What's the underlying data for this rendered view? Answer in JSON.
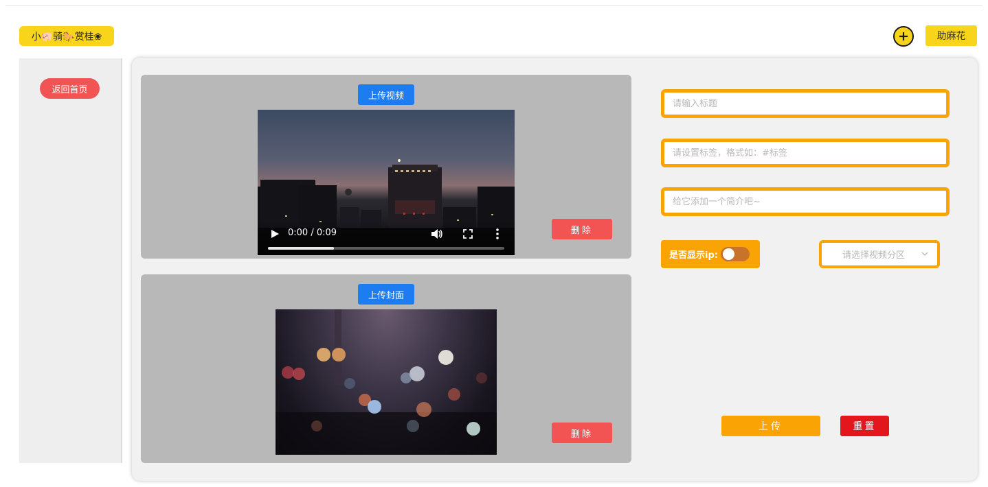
{
  "header": {
    "logo_text": "小🐖骑🐎赏桂❀",
    "add_icon": "plus-circle-icon",
    "helper_label": "助麻花"
  },
  "sidebar": {
    "back_label": "返回首页"
  },
  "video_panel": {
    "upload_label": "上传视频",
    "delete_label": "删除",
    "player": {
      "time": "0:00 / 0:09",
      "progress": 0.28,
      "icons": [
        "play-icon",
        "volume-icon",
        "fullscreen-icon",
        "more-vertical-icon"
      ]
    }
  },
  "cover_panel": {
    "upload_label": "上传封面",
    "delete_label": "删除"
  },
  "form": {
    "title_placeholder": "请输入标题",
    "tags_placeholder": "请设置标签，格式如：#标签",
    "intro_placeholder": "给它添加一个简介吧~",
    "show_ip_label": "是否显示ip:",
    "show_ip_value": false,
    "category_placeholder": "请选择视频分区",
    "upload_label": "上传",
    "reset_label": "重置"
  },
  "colors": {
    "yellow": "#f8d41b",
    "orange": "#f9a304",
    "blue": "#1e7cf2",
    "red": "#f25454",
    "reset_red": "#e3161e",
    "panel_gray": "#b8b8b8"
  }
}
